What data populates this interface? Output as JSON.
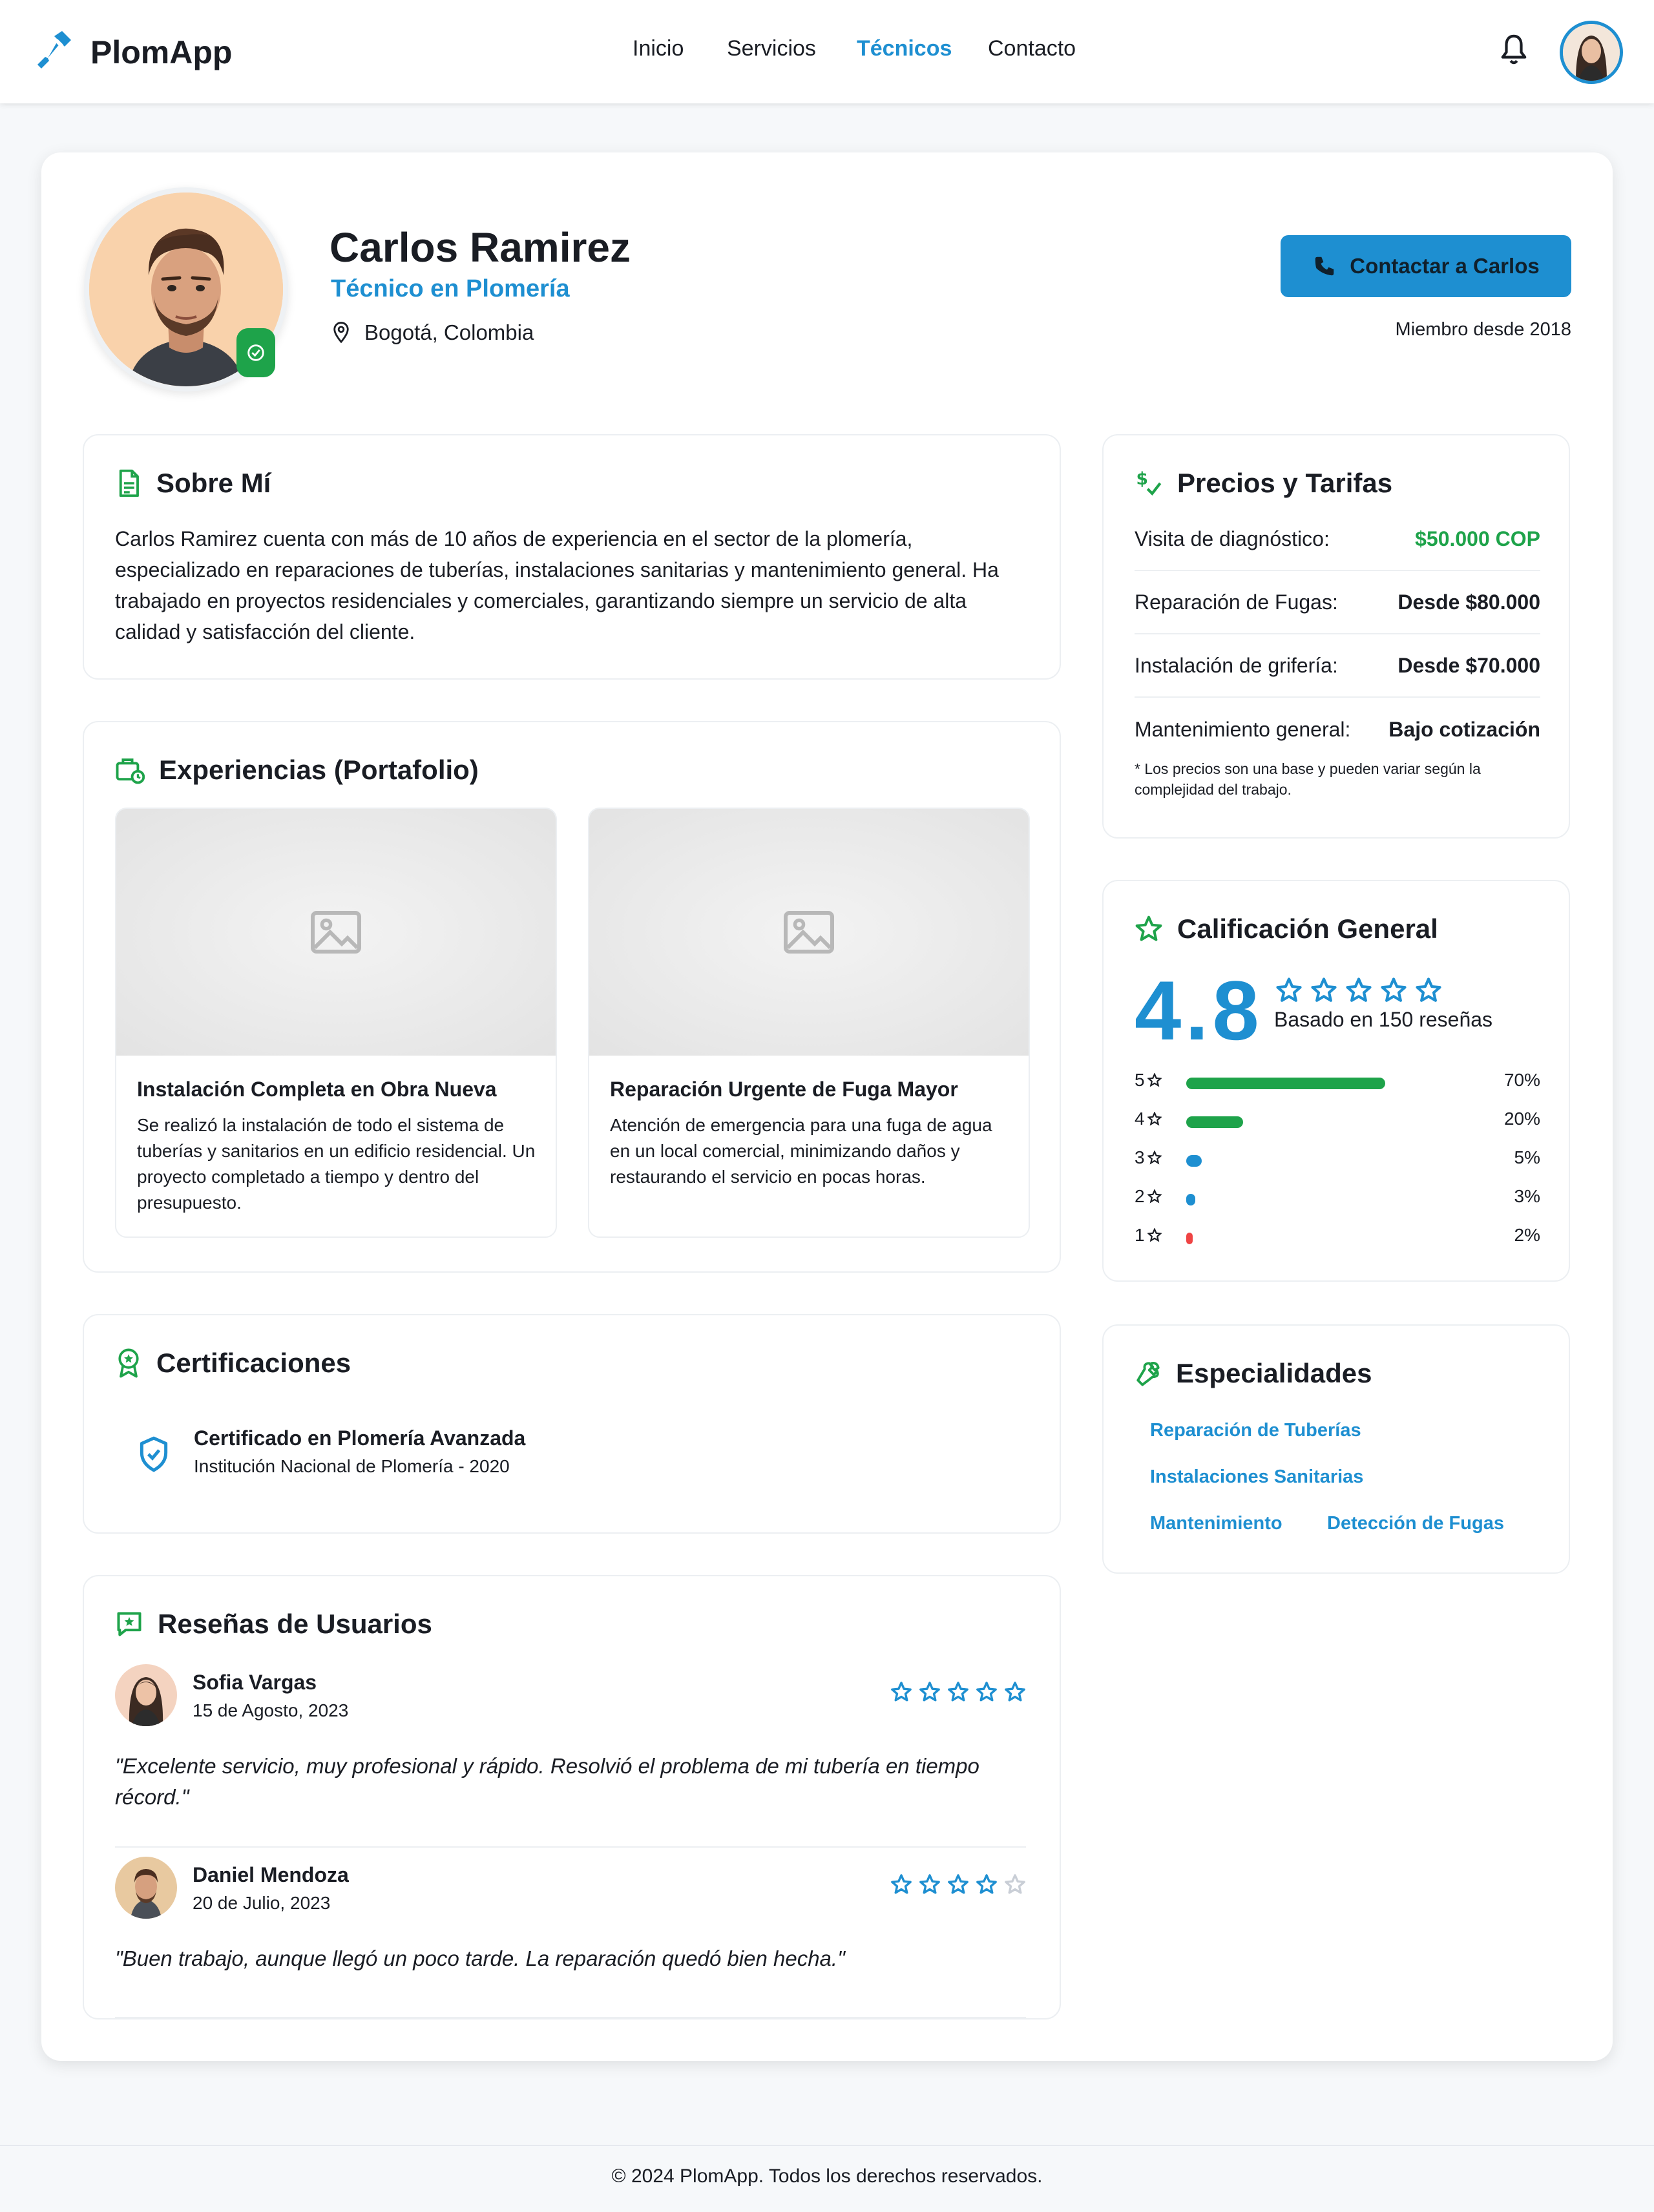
{
  "app": {
    "name": "PlomApp"
  },
  "nav": {
    "items": [
      "Inicio",
      "Servicios",
      "Técnicos",
      "Contacto"
    ],
    "active": "Técnicos"
  },
  "profile": {
    "name": "Carlos Ramirez",
    "role": "Técnico en Plomería",
    "location": "Bogotá, Colombia",
    "contact_label": "Contactar a Carlos",
    "member_since": "Miembro desde 2018"
  },
  "about": {
    "title": "Sobre Mí",
    "text": "Carlos Ramirez cuenta con más de 10 años de experiencia en el sector de la plomería, especializado en reparaciones de tuberías, instalaciones sanitarias y mantenimiento general. Ha trabajado en proyectos residenciales y comerciales, garantizando siempre un servicio de alta calidad y satisfacción del cliente."
  },
  "portfolio": {
    "title": "Experiencias (Portafolio)",
    "items": [
      {
        "title": "Instalación Completa en Obra Nueva",
        "desc": "Se realizó la instalación de todo el sistema de tuberías y sanitarios en un edificio residencial. Un proyecto completado a tiempo y dentro del presupuesto."
      },
      {
        "title": "Reparación Urgente de Fuga Mayor",
        "desc": "Atención de emergencia para una fuga de agua en un local comercial, minimizando daños y restaurando el servicio en pocas horas."
      }
    ]
  },
  "certifications": {
    "title": "Certificaciones",
    "items": [
      {
        "name": "Certificado en Plomería Avanzada",
        "institution": "Institución Nacional de Plomería - 2020"
      }
    ]
  },
  "reviews": {
    "title": "Reseñas de Usuarios",
    "items": [
      {
        "name": "Sofia Vargas",
        "date": "15 de Agosto, 2023",
        "text": "\"Excelente servicio, muy profesional y rápido. Resolvió el problema de mi tubería en tiempo récord.\"",
        "stars": 5
      },
      {
        "name": "Daniel Mendoza",
        "date": "20 de Julio, 2023",
        "text": "\"Buen trabajo, aunque llegó un poco tarde. La reparación quedó bien hecha.\"",
        "stars": 4
      }
    ]
  },
  "prices": {
    "title": "Precios y Tarifas",
    "items": [
      {
        "label": "Visita de diagnóstico:",
        "value": "$50.000 COP",
        "highlight": true
      },
      {
        "label": "Reparación de Fugas:",
        "value": "Desde $80.000",
        "highlight": false
      },
      {
        "label": "Instalación de grifería:",
        "value": "Desde $70.000",
        "highlight": false
      },
      {
        "label": "Mantenimiento general:",
        "value": "Bajo cotización",
        "highlight": false
      }
    ],
    "note": "* Los precios son una base y pueden variar según la complejidad del trabajo."
  },
  "rating": {
    "title": "Calificación General",
    "value": "4.8",
    "based_on": "Basado en 150 reseñas",
    "breakdown": [
      {
        "star": "5",
        "percent": 70,
        "label": "70%",
        "color": "#1ea34a"
      },
      {
        "star": "4",
        "percent": 20,
        "label": "20%",
        "color": "#1ea34a"
      },
      {
        "star": "3",
        "percent": 5,
        "label": "5%",
        "color": "#1e8fd1"
      },
      {
        "star": "2",
        "percent": 3,
        "label": "3%",
        "color": "#1e8fd1"
      },
      {
        "star": "1",
        "percent": 2,
        "label": "2%",
        "color": "#ef4444"
      }
    ]
  },
  "specialties": {
    "title": "Especialidades",
    "tags": [
      "Reparación de Tuberías",
      "Instalaciones Sanitarias",
      "Mantenimiento",
      "Detección de Fugas"
    ]
  },
  "footer": {
    "text": "© 2024 PlomApp. Todos los derechos reservados."
  },
  "colors": {
    "primary": "#1e8fd1",
    "accent_green": "#1ea34a",
    "danger": "#ef4444",
    "star_empty": "#c9ced6"
  },
  "icons": [
    "wrench-icon",
    "bell-icon",
    "location-pin-icon",
    "phone-icon",
    "document-icon",
    "briefcase-icon",
    "award-icon",
    "shield-check-icon",
    "star-message-icon",
    "dollar-check-icon",
    "star-icon",
    "image-placeholder-icon",
    "verified-badge-icon"
  ]
}
